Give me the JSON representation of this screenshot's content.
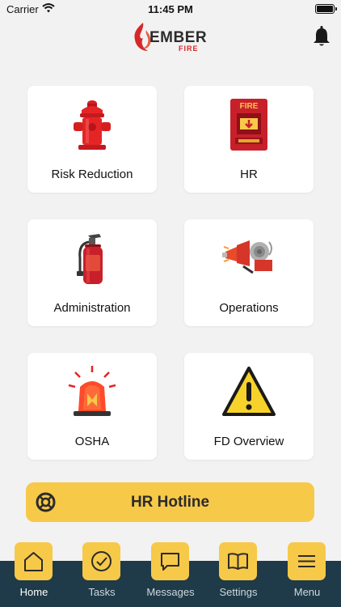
{
  "status_bar": {
    "carrier": "Carrier",
    "time": "11:45 PM"
  },
  "brand": {
    "name": "EMBER",
    "sub": "FIRE"
  },
  "cards": [
    {
      "label": "Risk Reduction",
      "icon": "fire-hydrant-icon"
    },
    {
      "label": "HR",
      "icon": "fire-alarm-icon"
    },
    {
      "label": "Administration",
      "icon": "fire-extinguisher-icon"
    },
    {
      "label": "Operations",
      "icon": "siren-horn-icon"
    },
    {
      "label": "OSHA",
      "icon": "emergency-light-icon"
    },
    {
      "label": "FD Overview",
      "icon": "warning-icon"
    }
  ],
  "hotline": {
    "label": "HR Hotline"
  },
  "tabs": [
    {
      "label": "Home",
      "icon": "home-icon",
      "active": true
    },
    {
      "label": "Tasks",
      "icon": "check-icon"
    },
    {
      "label": "Messages",
      "icon": "message-icon"
    },
    {
      "label": "Settings",
      "icon": "book-icon"
    },
    {
      "label": "Menu",
      "icon": "menu-icon"
    }
  ],
  "colors": {
    "accent": "#f7c948",
    "tabbar": "#1f3a48",
    "brand_red": "#d62828"
  }
}
